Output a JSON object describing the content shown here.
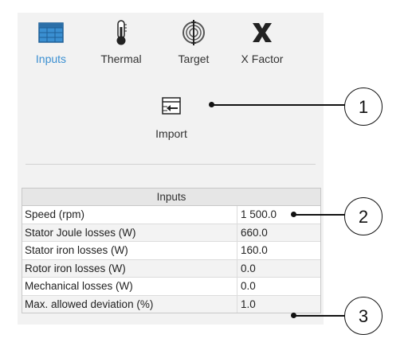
{
  "toolbar": {
    "items": [
      {
        "label": "Inputs",
        "icon": "table-icon",
        "active": true
      },
      {
        "label": "Thermal",
        "icon": "thermometer-icon",
        "active": false
      },
      {
        "label": "Target",
        "icon": "target-icon",
        "active": false
      },
      {
        "label": "X Factor",
        "icon": "x-factor-icon",
        "active": false
      }
    ]
  },
  "import": {
    "label": "Import",
    "icon": "import-icon"
  },
  "table": {
    "title": "Inputs",
    "rows": [
      {
        "name": "Speed (rpm)",
        "value": "1 500.0"
      },
      {
        "name": "Stator Joule losses (W)",
        "value": "660.0"
      },
      {
        "name": "Stator iron losses (W)",
        "value": "160.0"
      },
      {
        "name": "Rotor iron losses (W)",
        "value": "0.0"
      },
      {
        "name": "Mechanical losses (W)",
        "value": "0.0"
      },
      {
        "name": "Max. allowed deviation (%)",
        "value": "1.0"
      }
    ]
  },
  "callouts": [
    "1",
    "2",
    "3"
  ],
  "colors": {
    "accent": "#3a8fd1",
    "panel": "#f2f2f2"
  }
}
